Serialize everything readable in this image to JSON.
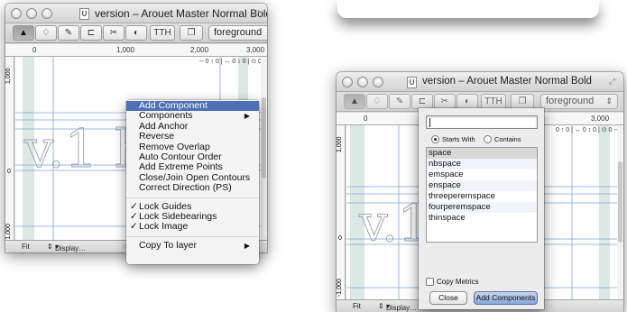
{
  "colors": {
    "highlight": "#4e6fb4",
    "canvas_line_blue": "#7fa6d6",
    "sidebearing_fill": "#dbe8e4",
    "glyph_stroke": "#9aa0a8"
  },
  "window_left": {
    "title": "version – Arouet Master Normal Bold",
    "doc_badge": "U",
    "toolbar": {
      "buttons": [
        {
          "icon": "arrow-pointer-icon",
          "glyph": "▲"
        },
        {
          "icon": "pen-nib-icon",
          "glyph": "♢"
        },
        {
          "icon": "pencil-icon",
          "glyph": "✎"
        },
        {
          "icon": "guide-tool-icon",
          "glyph": "⊏"
        },
        {
          "icon": "knife-tool-icon",
          "glyph": "✂"
        },
        {
          "icon": "shapes-tool-icon",
          "glyph": "◐"
        },
        {
          "icon": "measure-tool-icon",
          "glyph": "TTH"
        },
        {
          "icon": "layer-copy-icon",
          "glyph": "❐"
        }
      ],
      "layer_select": "foreground"
    },
    "ruler": {
      "left": "0",
      "mid": "1,000",
      "right1": "2,000",
      "right2": "3,000"
    },
    "ruler_v": [
      "1,000",
      "0",
      "-1,000"
    ],
    "coords": "-- 0 ↑ 0 | ↔ 0 ↕ 0 | ⊙ 0 -- 0",
    "glyph_text": "v.1 hf",
    "status": {
      "zoom": "Fit",
      "display": "Display…"
    }
  },
  "context_menu": {
    "items": [
      {
        "label": "Add Component",
        "highlighted": true
      },
      {
        "label": "Components",
        "submenu": "▶"
      },
      {
        "label": "Add Anchor"
      },
      {
        "label": "Reverse"
      },
      {
        "label": "Remove Overlap"
      },
      {
        "label": "Auto Contour Order"
      },
      {
        "label": "Add Extreme Points"
      },
      {
        "label": "Close/Join Open Contours"
      },
      {
        "label": "Correct Direction (PS)"
      }
    ],
    "checks": [
      {
        "label": "Lock Guides",
        "mark": "✓"
      },
      {
        "label": "Lock Sidebearings",
        "mark": "✓"
      },
      {
        "label": "Lock Image",
        "mark": "✓"
      }
    ],
    "copy_layer": {
      "label": "Copy To layer",
      "submenu": "▶"
    }
  },
  "window_right": {
    "title": "version – Arouet Master Normal Bold",
    "doc_badge": "U",
    "layer_select": "foreground",
    "ruler": {
      "left": "0",
      "right": "3,000"
    },
    "ruler_v": [
      "1,000",
      "0",
      "-1,000"
    ],
    "coords": "0 ↑ 0 | ↔ 0 ↕ 0 | ⊙ 0 -- 0",
    "status": {
      "zoom": "Fit",
      "display": "Display…"
    }
  },
  "component_panel": {
    "search_value": "",
    "radio_starts": "Starts With",
    "radio_contains": "Contains",
    "selected_mode": "starts",
    "rows": [
      "space",
      "nbspace",
      "emspace",
      "enspace",
      "threeperemspace",
      "fourperemspace",
      "thinspace"
    ],
    "copy_metrics": "Copy Metrics",
    "close_btn": "Close",
    "add_btn": "Add Components"
  }
}
